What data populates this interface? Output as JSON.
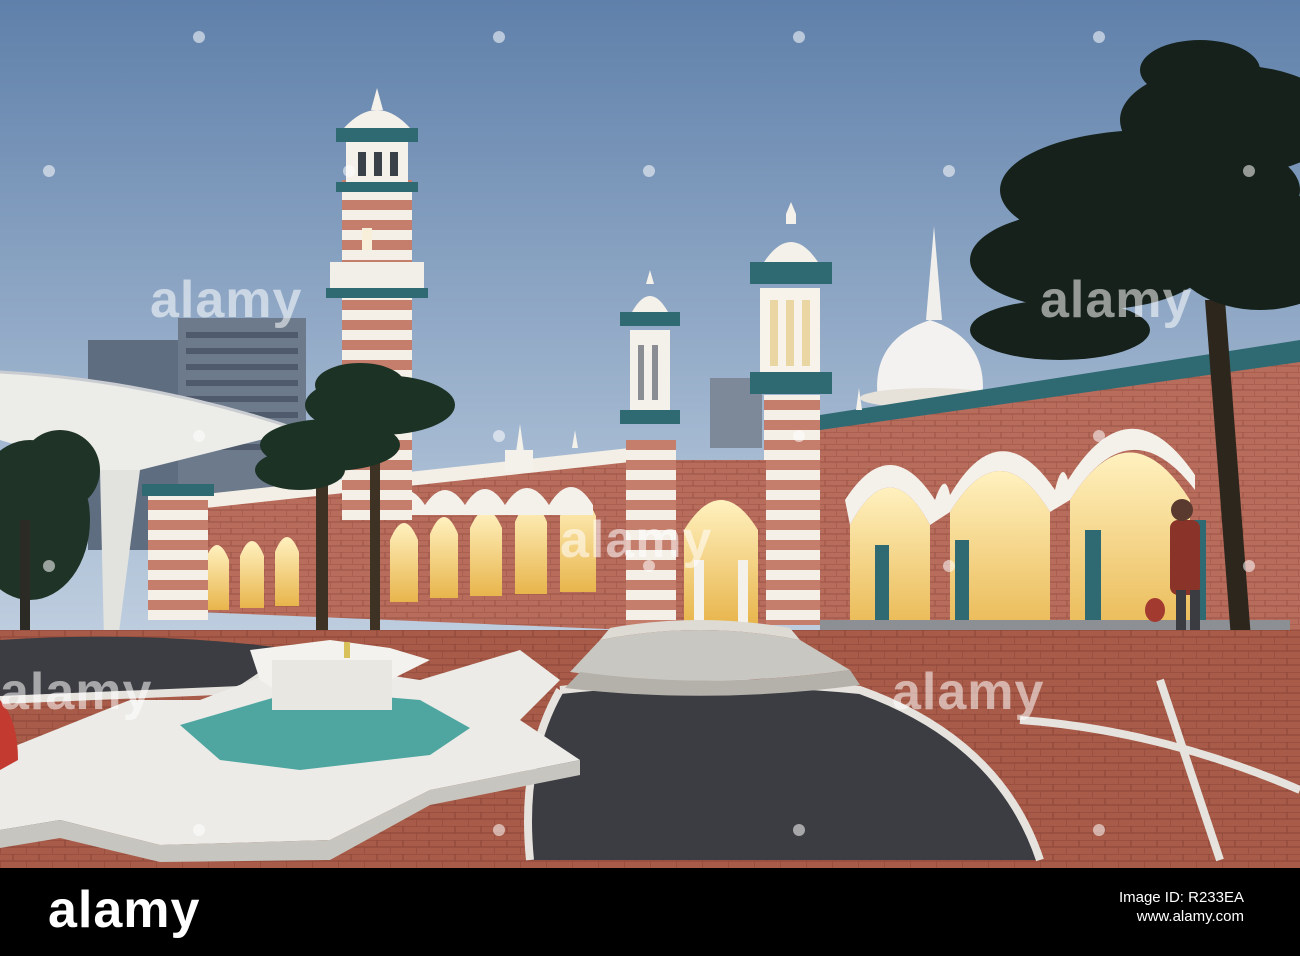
{
  "watermark": {
    "text": "alamy",
    "color": "#ffffff"
  },
  "footer": {
    "logo": "alamy",
    "image_id_label": "Image ID: R233EA",
    "site": "www.alamy.com",
    "background": "#000000"
  },
  "palette": {
    "sky_top": "#5f80aa",
    "sky_bottom": "#dde6ee",
    "brick": "#b5695a",
    "stripe": "#f4f0ea",
    "accent_teal": "#2f6a72",
    "glow": "#f5c95e",
    "plaza_brick": "#a65a48",
    "plaza_grey": "#3d3e43"
  }
}
